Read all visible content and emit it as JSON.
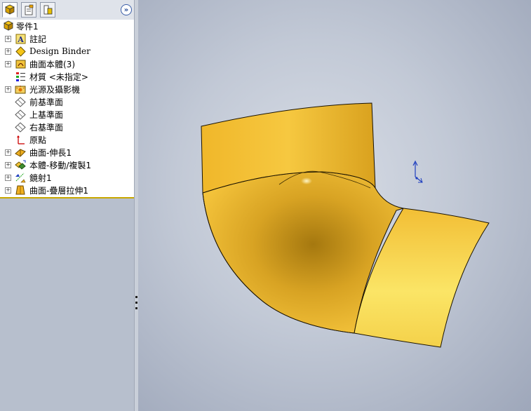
{
  "feature_tree": {
    "root_label": "零件1",
    "items": [
      {
        "label": "註記",
        "expandable": true,
        "icon": "annotation-icon"
      },
      {
        "label": "Design Binder",
        "expandable": true,
        "icon": "design-binder-icon"
      },
      {
        "label": "曲面本體(3)",
        "expandable": true,
        "icon": "surface-bodies-icon"
      },
      {
        "label": "材質 <未指定>",
        "expandable": false,
        "icon": "material-icon"
      },
      {
        "label": "光源及攝影機",
        "expandable": true,
        "icon": "lights-cameras-icon"
      },
      {
        "label": "前基準面",
        "expandable": false,
        "icon": "plane-icon"
      },
      {
        "label": "上基準面",
        "expandable": false,
        "icon": "plane-icon"
      },
      {
        "label": "右基準面",
        "expandable": false,
        "icon": "plane-icon"
      },
      {
        "label": "原點",
        "expandable": false,
        "icon": "origin-icon"
      },
      {
        "label": "曲面-伸長1",
        "expandable": true,
        "icon": "surface-extrude-icon"
      },
      {
        "label": "本體-移動/複製1",
        "expandable": true,
        "icon": "move-copy-body-icon"
      },
      {
        "label": "鏡射1",
        "expandable": true,
        "icon": "mirror-icon"
      },
      {
        "label": "曲面-疊層拉伸1",
        "expandable": true,
        "icon": "surface-loft-icon"
      }
    ]
  },
  "panel_tabs": [
    "featuremanager-tab-icon",
    "propertymanager-tab-icon",
    "configurationmanager-tab-icon"
  ],
  "expand_button": "»",
  "colors": {
    "surface_yellow": "#f2c032",
    "panel_bg": "#b7bfcd",
    "viewport_bg": "#c6ccd8",
    "triad_blue": "#1f3fbf"
  }
}
